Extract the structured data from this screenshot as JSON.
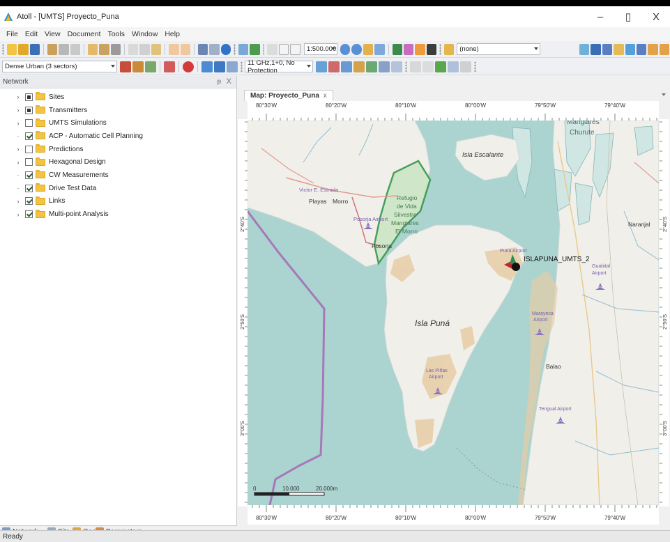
{
  "window": {
    "title": "Atoll - [UMTS] Proyecto_Puna",
    "minimize": "–",
    "maximize": "▯",
    "close": "X"
  },
  "menu": [
    "File",
    "Edit",
    "View",
    "Document",
    "Tools",
    "Window",
    "Help"
  ],
  "toolbar1": {
    "scale": "1:500.000",
    "filter": "(none)"
  },
  "toolbar2": {
    "environment": "Dense Urban (3 sectors)",
    "frequency": "11 GHz,1+0, No Protection"
  },
  "left_panel": {
    "title": "Network",
    "pin": "ᵽ",
    "close": "X",
    "tree": [
      {
        "label": "Sites",
        "check": "mixed",
        "expandable": true
      },
      {
        "label": "Transmitters",
        "check": "mixed",
        "expandable": true
      },
      {
        "label": "UMTS Simulations",
        "check": "none",
        "expandable": true
      },
      {
        "label": "ACP - Automatic Cell Planning",
        "check": "checked",
        "expandable": false
      },
      {
        "label": "Predictions",
        "check": "none",
        "expandable": true
      },
      {
        "label": "Hexagonal Design",
        "check": "none",
        "expandable": true
      },
      {
        "label": "CW Measurements",
        "check": "checked",
        "expandable": false
      },
      {
        "label": "Drive Test Data",
        "check": "checked",
        "expandable": false
      },
      {
        "label": "Links",
        "check": "checked",
        "expandable": true
      },
      {
        "label": "Multi-point Analysis",
        "check": "checked",
        "expandable": true
      }
    ],
    "bottom_tabs": [
      "Network",
      "Site",
      "Geo",
      "Parameters"
    ]
  },
  "document_tab": {
    "label": "Map: Proyecto_Puna",
    "close": "x"
  },
  "rulers": {
    "longitude_labels": [
      "80°30'W",
      "80°20'W",
      "80°10'W",
      "80°00'W",
      "79°50'W",
      "79°40'W"
    ],
    "latitude_labels": [
      "2°40'S",
      "2°50'S",
      "3°00'S"
    ]
  },
  "map": {
    "places": [
      "Manglares",
      "Churute",
      "Isla Escalante",
      "Victor E. Estrada",
      "Playas",
      "Morro",
      "Posorja Airport",
      "Posorja",
      "Refugio",
      "de Vida",
      "Silvestre",
      "Manglares",
      "El Morro",
      "Puna Airport",
      "Isla Puná",
      "Naranjal",
      "Guabital",
      "Airport",
      "Marayeca",
      "Airport",
      "Balao",
      "Las Piñas",
      "Airport",
      "Tengual Airport"
    ],
    "site_label": "ISLAPUNA_UMTS_2",
    "scalebar": [
      "0",
      "10.000",
      "20.000m"
    ],
    "colors": {
      "water": "#abd3d0",
      "land": "#f1efe9",
      "sand": "#e6cca6",
      "reserve": "#3f9b56",
      "boundary": "#a678b9"
    }
  },
  "status": "Ready"
}
